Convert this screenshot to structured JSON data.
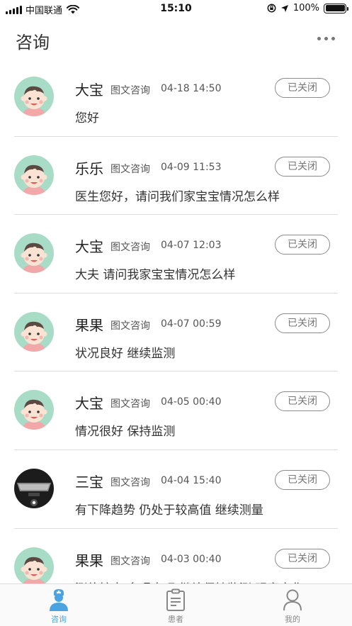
{
  "status_bar": {
    "carrier": "中国联通",
    "time": "15:10",
    "battery": "100%"
  },
  "header": {
    "title": "咨询",
    "more_icon": "more-horizontal-icon"
  },
  "consultations": [
    {
      "name": "大宝",
      "type": "图文咨询",
      "time": "04-18 14:50",
      "message": "您好",
      "status": "已关闭",
      "avatar": "baby"
    },
    {
      "name": "乐乐",
      "type": "图文咨询",
      "time": "04-09 11:53",
      "message": "医生您好，请问我们家宝宝情况怎么样",
      "status": "已关闭",
      "avatar": "baby"
    },
    {
      "name": "大宝",
      "type": "图文咨询",
      "time": "04-07 12:03",
      "message": "大夫 请问我家宝宝情况怎么样",
      "status": "已关闭",
      "avatar": "baby"
    },
    {
      "name": "果果",
      "type": "图文咨询",
      "time": "04-07 00:59",
      "message": "状况良好 继续监测",
      "status": "已关闭",
      "avatar": "baby"
    },
    {
      "name": "大宝",
      "type": "图文咨询",
      "time": "04-05 00:40",
      "message": "情况很好 保持监测",
      "status": "已关闭",
      "avatar": "baby"
    },
    {
      "name": "三宝",
      "type": "图文咨询",
      "time": "04-04 15:40",
      "message": "有下降趋势 仍处于较高值 继续测量",
      "status": "已关闭",
      "avatar": "laptop"
    },
    {
      "name": "果果",
      "type": "图文咨询",
      "time": "04-03 00:40",
      "message": "测值较高 多喝水吧 继续保持监测 观察变化",
      "status": "已关闭",
      "avatar": "baby"
    }
  ],
  "tabs": [
    {
      "label": "咨询",
      "icon": "doctor-icon",
      "active": true
    },
    {
      "label": "患者",
      "icon": "clipboard-icon",
      "active": false
    },
    {
      "label": "我的",
      "icon": "user-icon",
      "active": false
    }
  ],
  "colors": {
    "accent": "#4aa3e3",
    "avatar_bg": "#a8dcc6",
    "divider": "#dcdcdc"
  }
}
